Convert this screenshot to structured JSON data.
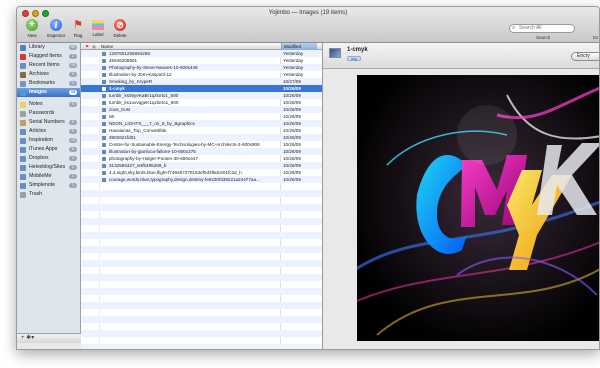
{
  "window": {
    "title": "Yojimbo — Images (19 items)"
  },
  "toolbar": {
    "buttons": [
      {
        "label": "New"
      },
      {
        "label": "Inspector"
      },
      {
        "label": "Flag"
      },
      {
        "label": "Label"
      },
      {
        "label": "Delete"
      }
    ],
    "search_placeholder": "Search All",
    "search_label": "Search",
    "extra_label": "Ex"
  },
  "sidebar": {
    "items": [
      {
        "label": "Library",
        "count": "99",
        "color": "#5b7fb8"
      },
      {
        "label": "Flagged Items",
        "count": "2",
        "color": "#d83a2c"
      },
      {
        "label": "Recent Items",
        "count": "15",
        "color": "#6b8fc4"
      },
      {
        "label": "Archives",
        "count": "9",
        "color": "#8a6a3a"
      },
      {
        "label": "Bookmarks",
        "count": "4",
        "color": "#7a96c0"
      },
      {
        "label": "Images",
        "count": "19",
        "color": "#4b9bd8"
      },
      {
        "label": "Notes",
        "count": "9",
        "color": "#e8d26a"
      },
      {
        "label": "Passwords",
        "count": "",
        "color": "#9aa0a8"
      },
      {
        "label": "Serial Numbers",
        "count": "5",
        "color": "#c0a060"
      },
      {
        "label": "Articles",
        "count": "5",
        "color": "#6a8ec0"
      },
      {
        "label": "Inspiration",
        "count": "15",
        "color": "#6a8ec0"
      },
      {
        "label": "iTunes Apps",
        "count": "6",
        "color": "#6a8ec0"
      },
      {
        "label": "Dropbox",
        "count": "1",
        "color": "#6a8ec0"
      },
      {
        "label": "Helveblog/Sites",
        "count": "1",
        "color": "#6a8ec0"
      },
      {
        "label": "MobileMe",
        "count": "1",
        "color": "#6a8ec0"
      },
      {
        "label": "Simplenote",
        "count": "1",
        "color": "#6a8ec0"
      },
      {
        "label": "Trash",
        "count": "",
        "color": "#9aa0a8"
      }
    ],
    "bottom_controls": "+ ✱▾"
  },
  "list": {
    "columns": {
      "name": "Name",
      "modified": "Modified"
    },
    "rows": [
      {
        "name": "1287601255894268",
        "modified": "Yesterday"
      },
      {
        "name": "45646208601",
        "modified": "Yesterday"
      },
      {
        "name": "Photography-by-Steve-Neaves-10-600x449",
        "modified": "Yesterday"
      },
      {
        "name": "Illustration-by-Jörn-Kaspuhl-12",
        "modified": "Yesterday"
      },
      {
        "name": "Smoking_by_KrypeR",
        "modified": "10/27/09"
      },
      {
        "name": "1-cmyk",
        "modified": "10/26/09"
      },
      {
        "name": "tumblr_ks05yeKaBr1qzlorto1_500",
        "modified": "10/26/09"
      },
      {
        "name": "tumblr_ks1uvvqgeK1qzlorto1_500",
        "modified": "10/26/09"
      },
      {
        "name": "zoos_trust",
        "modified": "10/26/09"
      },
      {
        "name": "06",
        "modified": "10/26/09"
      },
      {
        "name": "NEON_LIGHTS___7_on_8_by_Bgraphics",
        "modified": "10/26/09"
      },
      {
        "name": "Havaianas_Top_Convertible",
        "modified": "10/26/09"
      },
      {
        "name": "3902621fd01",
        "modified": "10/26/09"
      },
      {
        "name": "Centre-for-Sustainable-Energy-Technologies-by-MC-Architects-3-600x908",
        "modified": "10/26/09"
      },
      {
        "name": "Illustration-by-gianluca-fallone-10-600x375",
        "modified": "10/26/09"
      },
      {
        "name": "photography-by-Holger-Pooten-30-600x447",
        "modified": "10/26/09"
      },
      {
        "name": "3132586327_84fb495289_b",
        "modified": "10/26/09"
      },
      {
        "name": "4,4,night,sky,birds,blue,flight-f749467270163ef0d3f5dc601fc2d_h",
        "modified": "10/26/09"
      },
      {
        "name": "courage,words,blue,typography,design,destiny-fe9230f339221a24477aa...",
        "modified": "10/26/09"
      }
    ],
    "selected_index": 5
  },
  "preview": {
    "title": "1-cmyk",
    "tag": "img",
    "button": "Encry"
  }
}
